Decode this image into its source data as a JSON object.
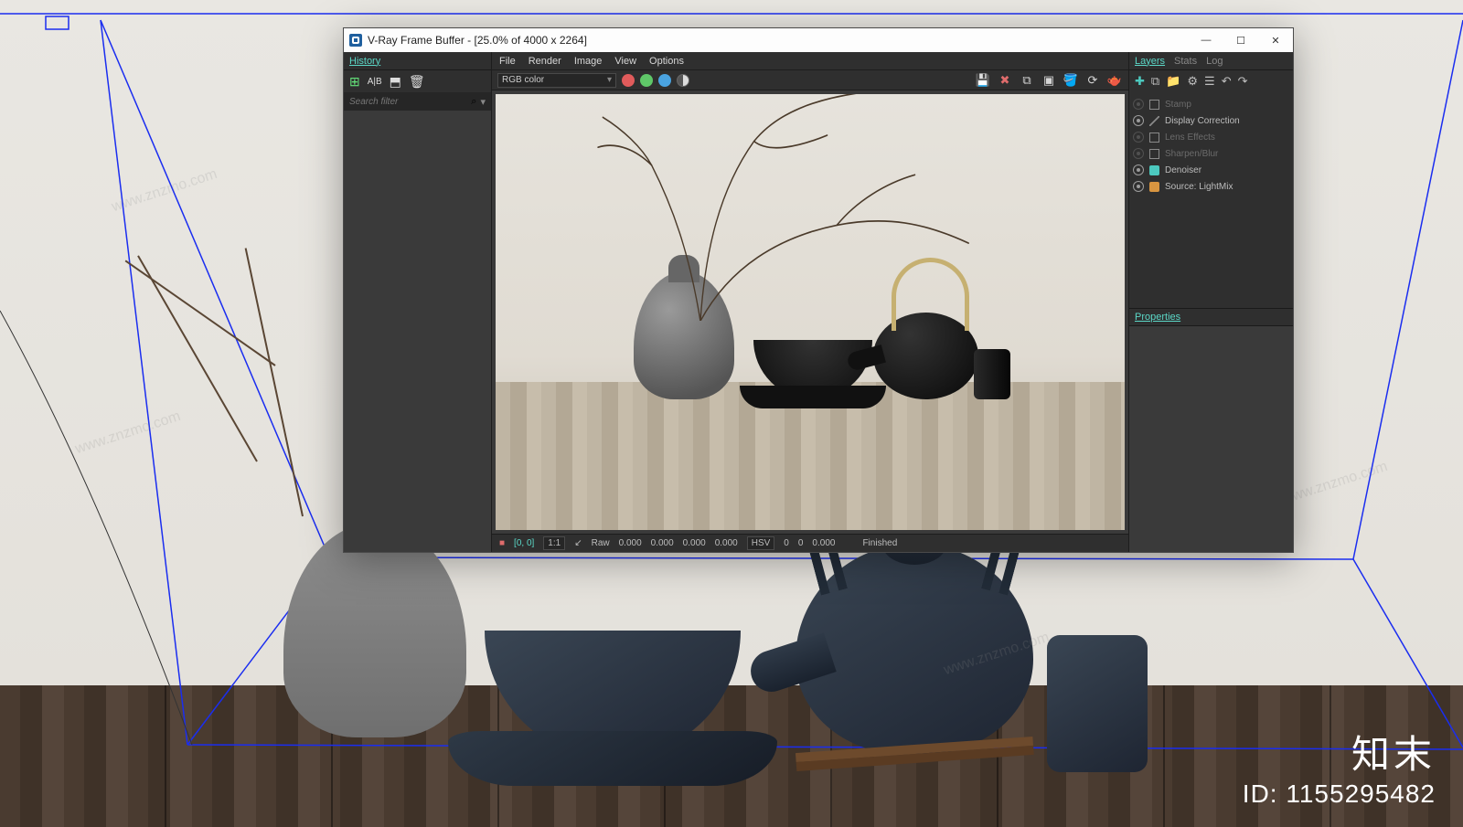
{
  "window": {
    "title": "V-Ray Frame Buffer - [25.0% of 4000 x 2264]",
    "controls": {
      "minimize": "—",
      "maximize": "☐",
      "close": "✕"
    }
  },
  "history": {
    "panel_title": "History",
    "search_placeholder": "Search filter",
    "search_icon": "⌕",
    "toolbar": {
      "save": "⊞",
      "ab": "A|B",
      "load": "⬒",
      "trash": "🗑"
    }
  },
  "menu": {
    "file": "File",
    "render": "Render",
    "image": "Image",
    "view": "View",
    "options": "Options"
  },
  "toolbar": {
    "channel": "RGB color",
    "icons": {
      "save": "💾",
      "savex": "✖",
      "region": "⧉",
      "render": "▣",
      "bucket": "🪣",
      "stop": "⟳",
      "teapot": "🫖"
    }
  },
  "status": {
    "coord": "[0, 0]",
    "scale_label": "1:1",
    "curve": "↙",
    "raw": "Raw",
    "v1": "0.000",
    "v2": "0.000",
    "v3": "0.000",
    "v4": "0.000",
    "hsv": "HSV",
    "h": "0",
    "s": "0",
    "v": "0.000",
    "state": "Finished"
  },
  "right": {
    "tabs": {
      "layers": "Layers",
      "stats": "Stats",
      "log": "Log"
    },
    "icons": {
      "add": "✚",
      "dup": "⧉",
      "fold": "📁",
      "opt": "⚙",
      "list": "☰",
      "undo": "↶",
      "redo": "↷"
    },
    "layers": [
      {
        "name": "Stamp",
        "dim": true,
        "icon": "box"
      },
      {
        "name": "Display Correction",
        "dim": false,
        "icon": "sl"
      },
      {
        "name": "Lens Effects",
        "dim": true,
        "icon": "box"
      },
      {
        "name": "Sharpen/Blur",
        "dim": true,
        "icon": "box"
      },
      {
        "name": "Denoiser",
        "dim": false,
        "icon": "d"
      },
      {
        "name": "Source: LightMix",
        "dim": false,
        "icon": "s"
      }
    ],
    "properties": "Properties"
  },
  "watermark": {
    "brand": "知末",
    "id": "ID: 1155295482"
  },
  "diag_wm": "www.znzmo.com"
}
